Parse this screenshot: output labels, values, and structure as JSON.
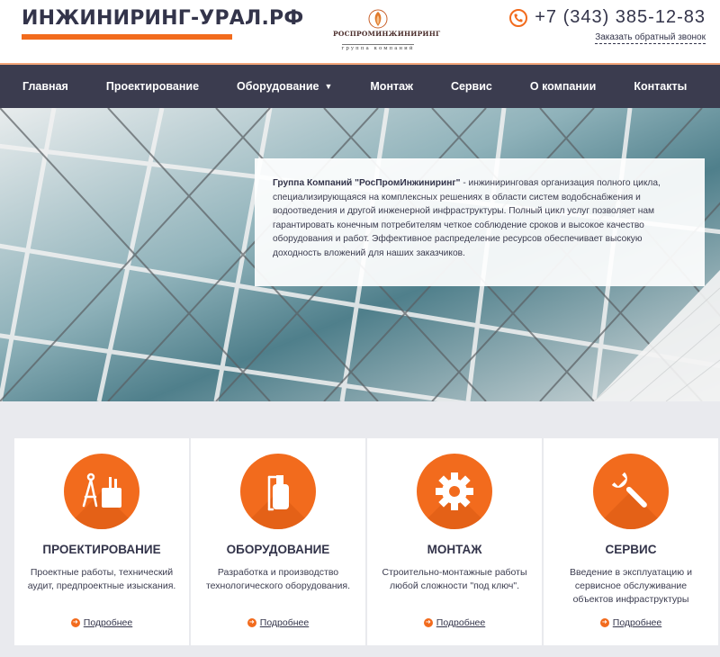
{
  "header": {
    "logo_text": "ИНЖИНИРИНГ-УРАЛ.РФ",
    "partner_name": "РОСПРОМИНЖИНИРИНГ",
    "partner_sub": "группа компаний",
    "phone": "+7 (343) 385-12-83",
    "callback": "Заказать обратный звонок"
  },
  "nav": {
    "items": [
      {
        "label": "Главная"
      },
      {
        "label": "Проектирование"
      },
      {
        "label": "Оборудование"
      },
      {
        "label": "Монтаж"
      },
      {
        "label": "Сервис"
      },
      {
        "label": "О компании"
      },
      {
        "label": "Контакты"
      }
    ]
  },
  "hero": {
    "company": "Группа Компаний \"РосПромИнжиниринг\"",
    "text": " - инжиниринговая организация полного цикла, специализирующаяся на комплексных решениях в области систем водобснабжения и водоотведения и другой инженерной инфраструктуры. Полный цикл услуг позволяет нам гарантировать конечным потребителям четкое соблюдение сроков и высокое качество оборудования и работ. Эффективное распределение ресурсов обеспечивает высокую доходность вложений для наших заказчиков."
  },
  "services": [
    {
      "title": "ПРОЕКТИРОВАНИЕ",
      "desc": "Проектные работы, технический аудит, предпроектные изыскания.",
      "more": "Подробнее",
      "icon": "compass-icon"
    },
    {
      "title": "ОБОРУДОВАНИЕ",
      "desc": "Разработка и производство технологического оборудования.",
      "more": "Подробнее",
      "icon": "sprayer-icon"
    },
    {
      "title": "МОНТАЖ",
      "desc": "Строительно-монтажные работы любой сложности \"под ключ\".",
      "more": "Подробнее",
      "icon": "gear-icon"
    },
    {
      "title": "СЕРВИС",
      "desc": "Введение в эксплуатацию и сервисное обслуживание объектов инфраструктуры",
      "more": "Подробнее",
      "icon": "wrench-icon"
    }
  ],
  "colors": {
    "accent": "#f26b1d",
    "nav_bg": "#3b3c4f",
    "text_dark": "#33344a"
  }
}
